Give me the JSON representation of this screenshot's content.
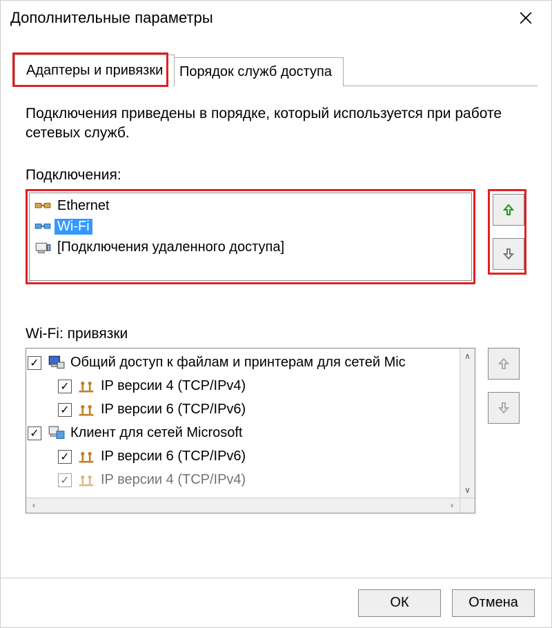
{
  "window": {
    "title": "Дополнительные параметры"
  },
  "tabs": {
    "active": "Адаптеры и привязки",
    "inactive": "Порядок служб доступа"
  },
  "description": "Подключения приведены в порядке, который используется при работе сетевых служб.",
  "connections": {
    "label": "Подключения:",
    "items": [
      {
        "name": "Ethernet",
        "icon": "ethernet",
        "selected": false
      },
      {
        "name": "Wi-Fi",
        "icon": "wifi",
        "selected": true
      },
      {
        "name": "[Подключения удаленного доступа]",
        "icon": "dialup",
        "selected": false
      }
    ]
  },
  "bindings": {
    "label": "Wi-Fi: привязки",
    "items": [
      {
        "text": "Общий доступ к файлам и принтерам для сетей Mic",
        "level": 0,
        "icon": "computer",
        "checked": true
      },
      {
        "text": "IP версии 4 (TCP/IPv4)",
        "level": 1,
        "icon": "protocol",
        "checked": true
      },
      {
        "text": "IP версии 6 (TCP/IPv6)",
        "level": 1,
        "icon": "protocol",
        "checked": true
      },
      {
        "text": "Клиент для сетей Microsoft",
        "level": 0,
        "icon": "client",
        "checked": true
      },
      {
        "text": "IP версии 6 (TCP/IPv6)",
        "level": 1,
        "icon": "protocol",
        "checked": true
      },
      {
        "text": "IP версии 4 (TCP/IPv4)",
        "level": 1,
        "icon": "protocol",
        "checked": true
      }
    ]
  },
  "buttons": {
    "ok": "ОК",
    "cancel": "Отмена"
  }
}
